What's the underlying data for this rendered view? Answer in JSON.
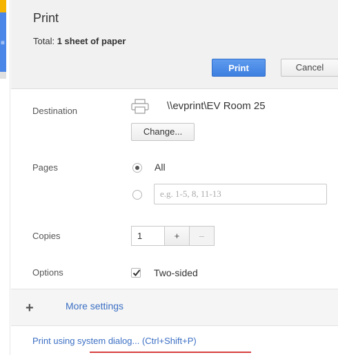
{
  "left_strip": {
    "glyph": "≡"
  },
  "header": {
    "title": "Print",
    "total_prefix": "Total:",
    "total_value": "1 sheet of paper",
    "print_button": "Print",
    "cancel_button": "Cancel"
  },
  "destination": {
    "label": "Destination",
    "name": "\\\\evprint\\EV Room 25",
    "change_button": "Change...",
    "icon": "printer-icon"
  },
  "pages": {
    "label": "Pages",
    "all_label": "All",
    "all_selected": true,
    "custom_placeholder": "e.g. 1-5, 8, 11-13"
  },
  "copies": {
    "label": "Copies",
    "value": "1",
    "increment": "+",
    "decrement": "–"
  },
  "options": {
    "label": "Options",
    "two_sided_label": "Two-sided",
    "two_sided_checked": true
  },
  "more_settings": {
    "icon": "plus-icon",
    "label": "More settings"
  },
  "footer": {
    "system_dialog_link": "Print using system dialog... (Ctrl+Shift+P)"
  },
  "colors": {
    "accent": "#3d7fe0",
    "link": "#3b6fc4",
    "header_bg": "#f1f1f1"
  }
}
